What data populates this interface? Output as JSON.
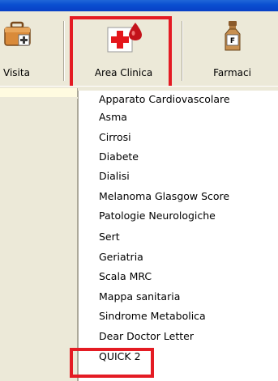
{
  "toolbar": {
    "visita": {
      "label": "Visita",
      "icon": "briefcase-medical-icon"
    },
    "area_clinica": {
      "label": "Area Clinica",
      "icon": "red-cross-drop-icon"
    },
    "farmaci": {
      "label": "Farmaci",
      "icon": "medicine-bottle-icon",
      "bottle_letter": "F"
    }
  },
  "menu": {
    "items": [
      "Apparato Cardiovascolare",
      "Asma",
      "Cirrosi",
      "Diabete",
      "Dialisi",
      "Melanoma Glasgow Score",
      "Patologie Neurologiche",
      "Sert",
      "Geriatria",
      "Scala MRC",
      "Mappa sanitaria",
      "Sindrome Metabolica",
      "Dear Doctor Letter",
      "QUICK 2"
    ]
  },
  "colors": {
    "titlebar": "#0a4fd1",
    "toolbar_bg": "#ece9d8",
    "highlight": "#e41b23",
    "input_bg": "#fffbe0"
  }
}
